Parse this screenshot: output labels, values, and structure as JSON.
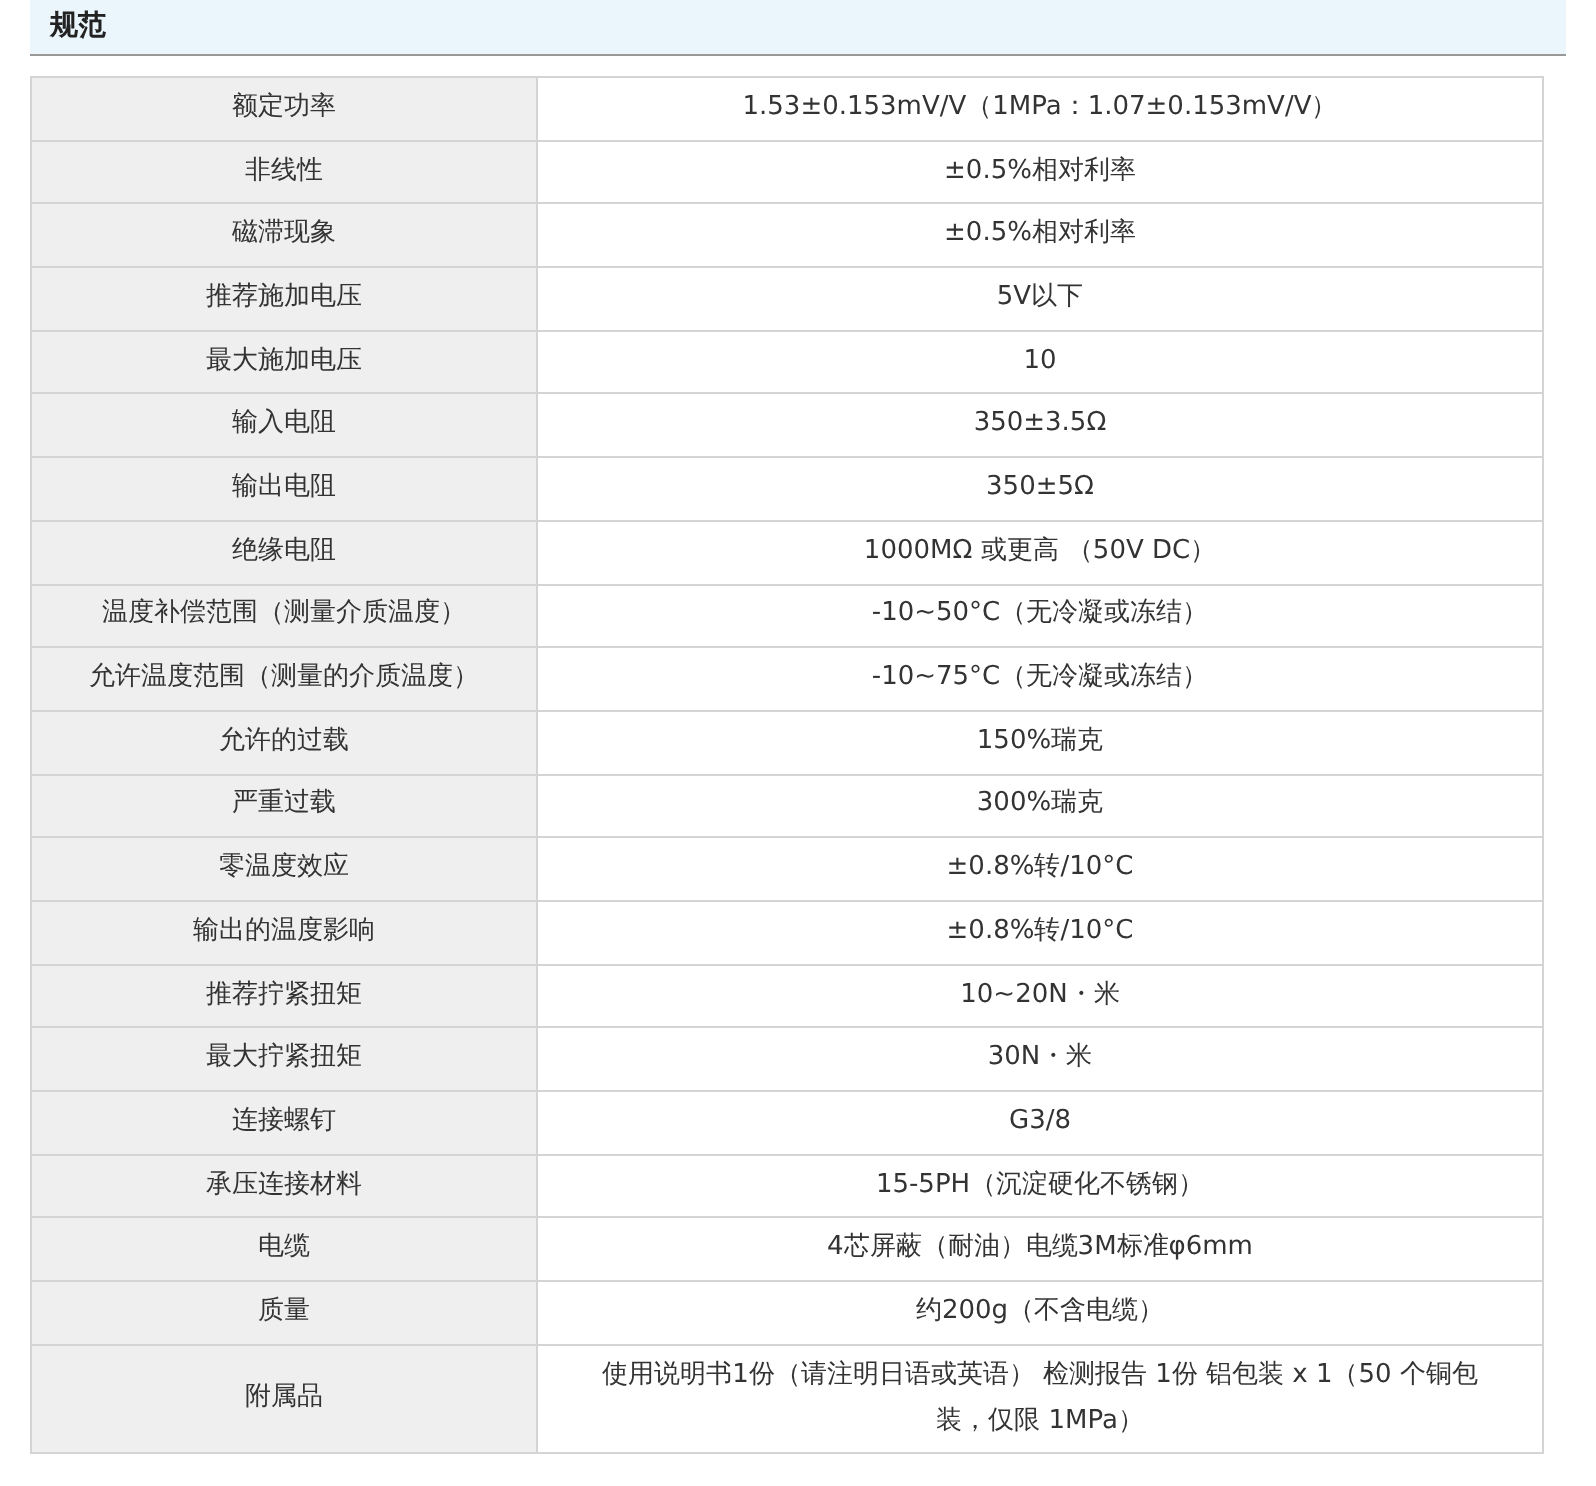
{
  "section": {
    "title": "规范"
  },
  "specs": [
    {
      "label": "额定功率",
      "value": "1.53±0.153mV/V（1MPa：1.07±0.153mV/V）"
    },
    {
      "label": "非线性",
      "value": "±0.5%相对利率"
    },
    {
      "label": "磁滞现象",
      "value": "±0.5%相对利率"
    },
    {
      "label": "推荐施加电压",
      "value": "5V以下"
    },
    {
      "label": "最大施加电压",
      "value": "10"
    },
    {
      "label": "输入电阻",
      "value": "350±3.5Ω"
    },
    {
      "label": "输出电阻",
      "value": "350±5Ω"
    },
    {
      "label": "绝缘电阻",
      "value": "1000MΩ 或更高 （50V DC）"
    },
    {
      "label": "温度补偿范围（测量介质温度）",
      "value": "-10~50°C（无冷凝或冻结）"
    },
    {
      "label": "允许温度范围（测量的介质温度）",
      "value": "-10~75°C（无冷凝或冻结）"
    },
    {
      "label": "允许的过载",
      "value": "150%瑞克"
    },
    {
      "label": "严重过载",
      "value": "300%瑞克"
    },
    {
      "label": "零温度效应",
      "value": "±0.8%转/10°C"
    },
    {
      "label": "输出的温度影响",
      "value": "±0.8%转/10°C"
    },
    {
      "label": "推荐拧紧扭矩",
      "value": "10~20N・米"
    },
    {
      "label": "最大拧紧扭矩",
      "value": "30N・米"
    },
    {
      "label": "连接螺钉",
      "value": "G3/8"
    },
    {
      "label": "承压连接材料",
      "value": "15-5PH（沉淀硬化不锈钢）"
    },
    {
      "label": "电缆",
      "value": "4芯屏蔽（耐油）电缆3M标准φ6mm"
    },
    {
      "label": "质量",
      "value": "约200g（不含电缆）"
    },
    {
      "label": "附属品",
      "value": "使用说明书1份（请注明日语或英语） 检测报告 1份 铝包装 x 1（50 个铜包装，仅限 1MPa）"
    }
  ]
}
